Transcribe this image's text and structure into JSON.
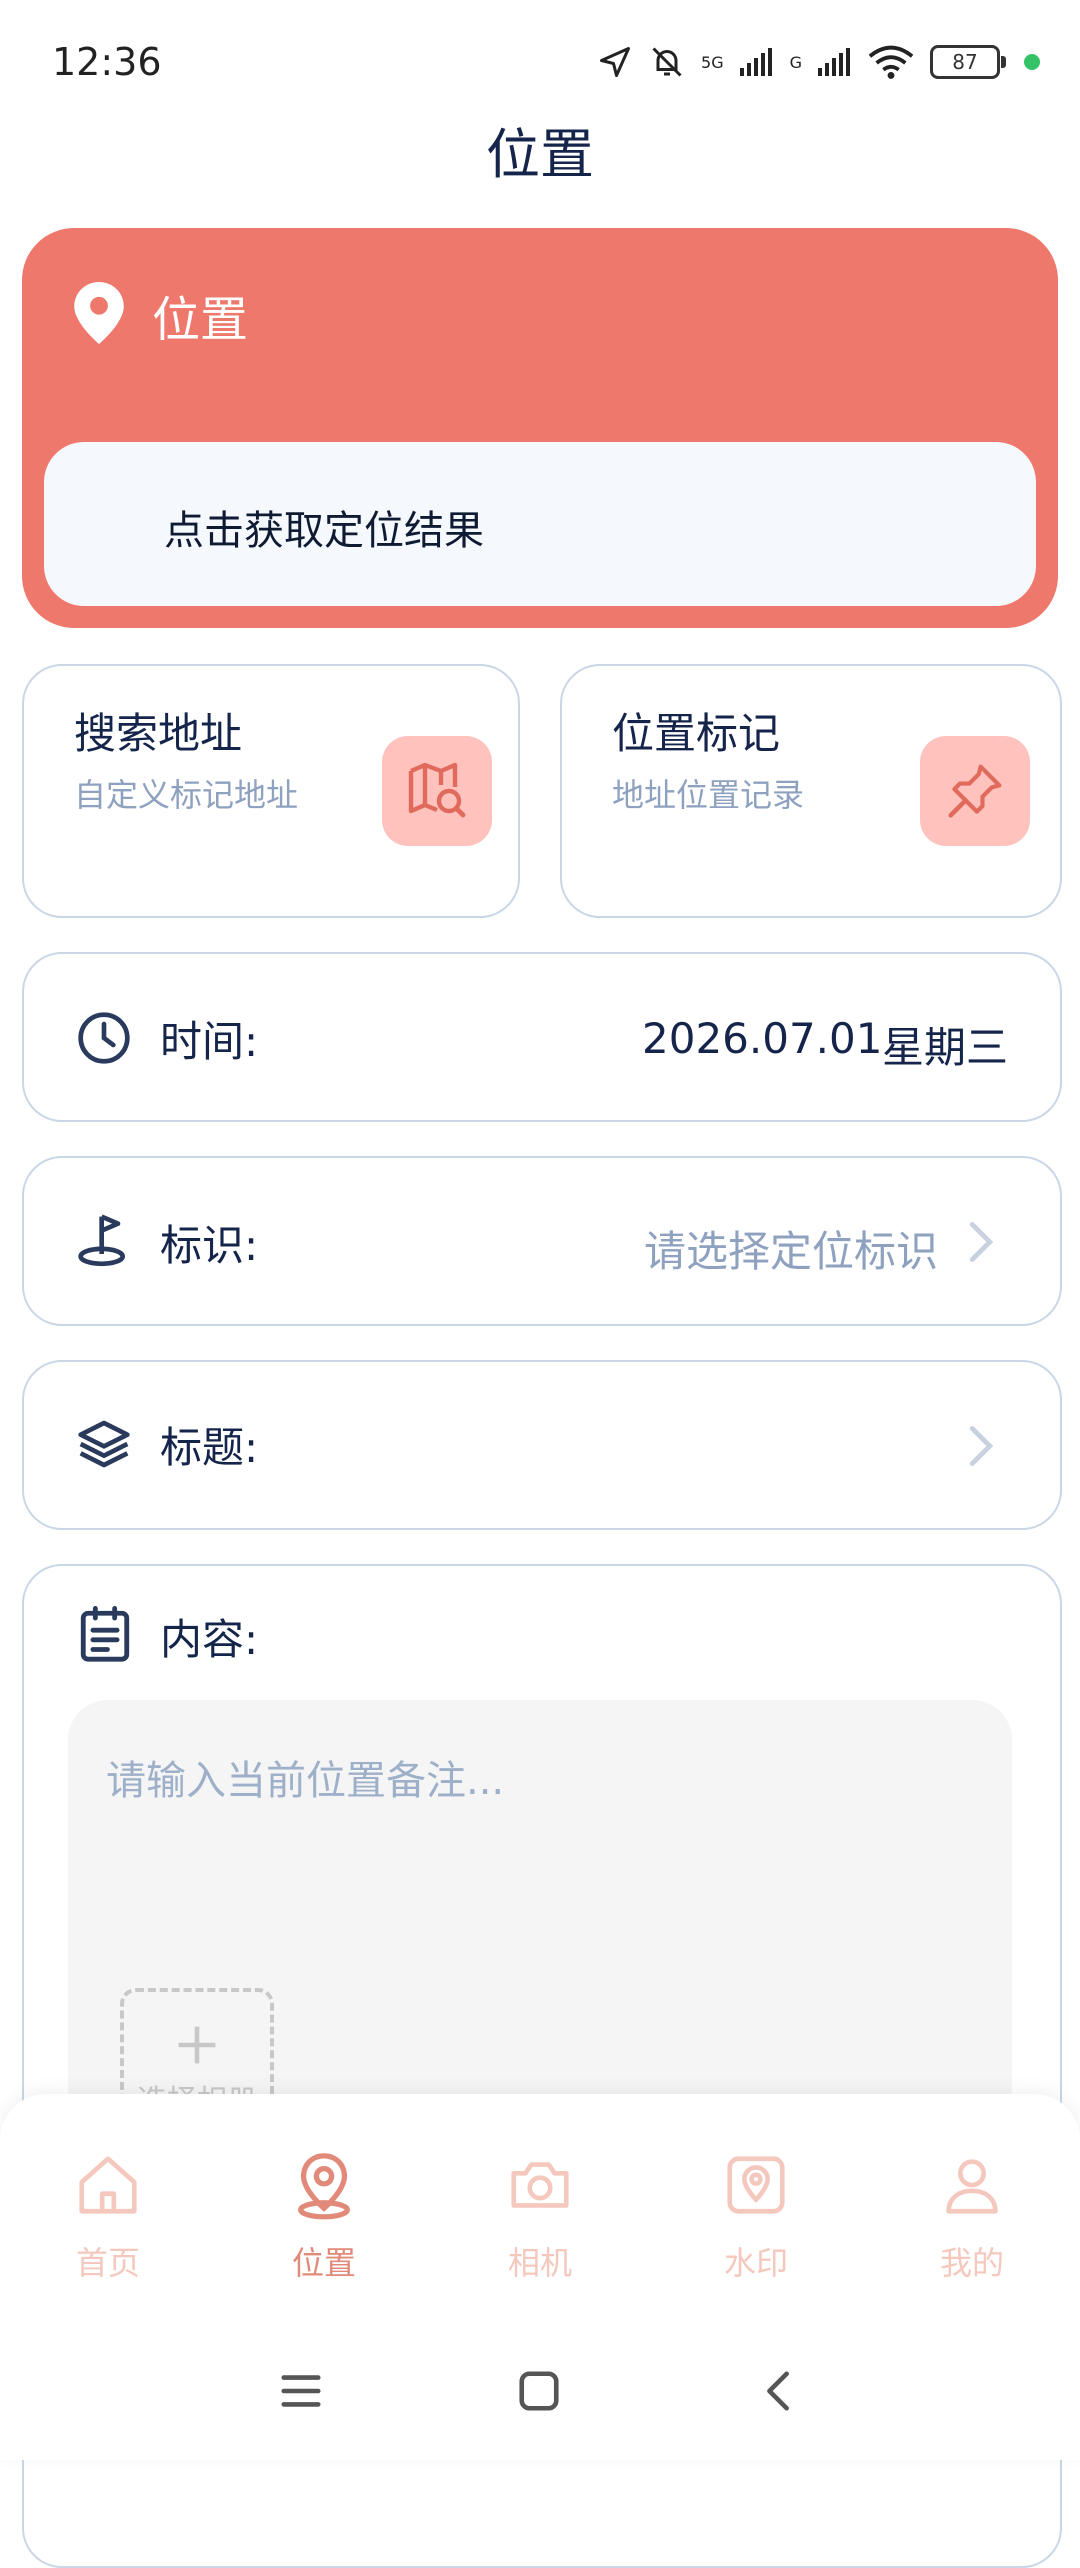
{
  "status_bar": {
    "time": "12:36",
    "network_5g": "5G",
    "network_g": "G",
    "battery": "87"
  },
  "page": {
    "title": "位置"
  },
  "location_card": {
    "label": "位置",
    "result_text": "点击获取定位结果"
  },
  "tiles": [
    {
      "title": "搜索地址",
      "subtitle": "自定义标记地址",
      "icon": "map-search-icon"
    },
    {
      "title": "位置标记",
      "subtitle": "地址位置记录",
      "icon": "pin-icon"
    }
  ],
  "rows": {
    "time": {
      "label": "时间:",
      "date": "2026.07.01",
      "weekday": "星期三"
    },
    "marker": {
      "label": "标识:",
      "placeholder": "请选择定位标识"
    },
    "title": {
      "label": "标题:"
    },
    "content": {
      "label": "内容:",
      "placeholder": "请输入当前位置备注...",
      "photo_label": "选择相册"
    }
  },
  "bottom_nav": [
    {
      "label": "首页",
      "icon": "home-icon"
    },
    {
      "label": "位置",
      "icon": "location-icon",
      "active": true
    },
    {
      "label": "相机",
      "icon": "camera-icon"
    },
    {
      "label": "水印",
      "icon": "watermark-icon"
    },
    {
      "label": "我的",
      "icon": "profile-icon"
    }
  ],
  "colors": {
    "accent": "#ee786c",
    "tile_icon_bg": "#ffc2bd",
    "text_dark": "#15244a",
    "text_muted": "#8ea1bf"
  }
}
